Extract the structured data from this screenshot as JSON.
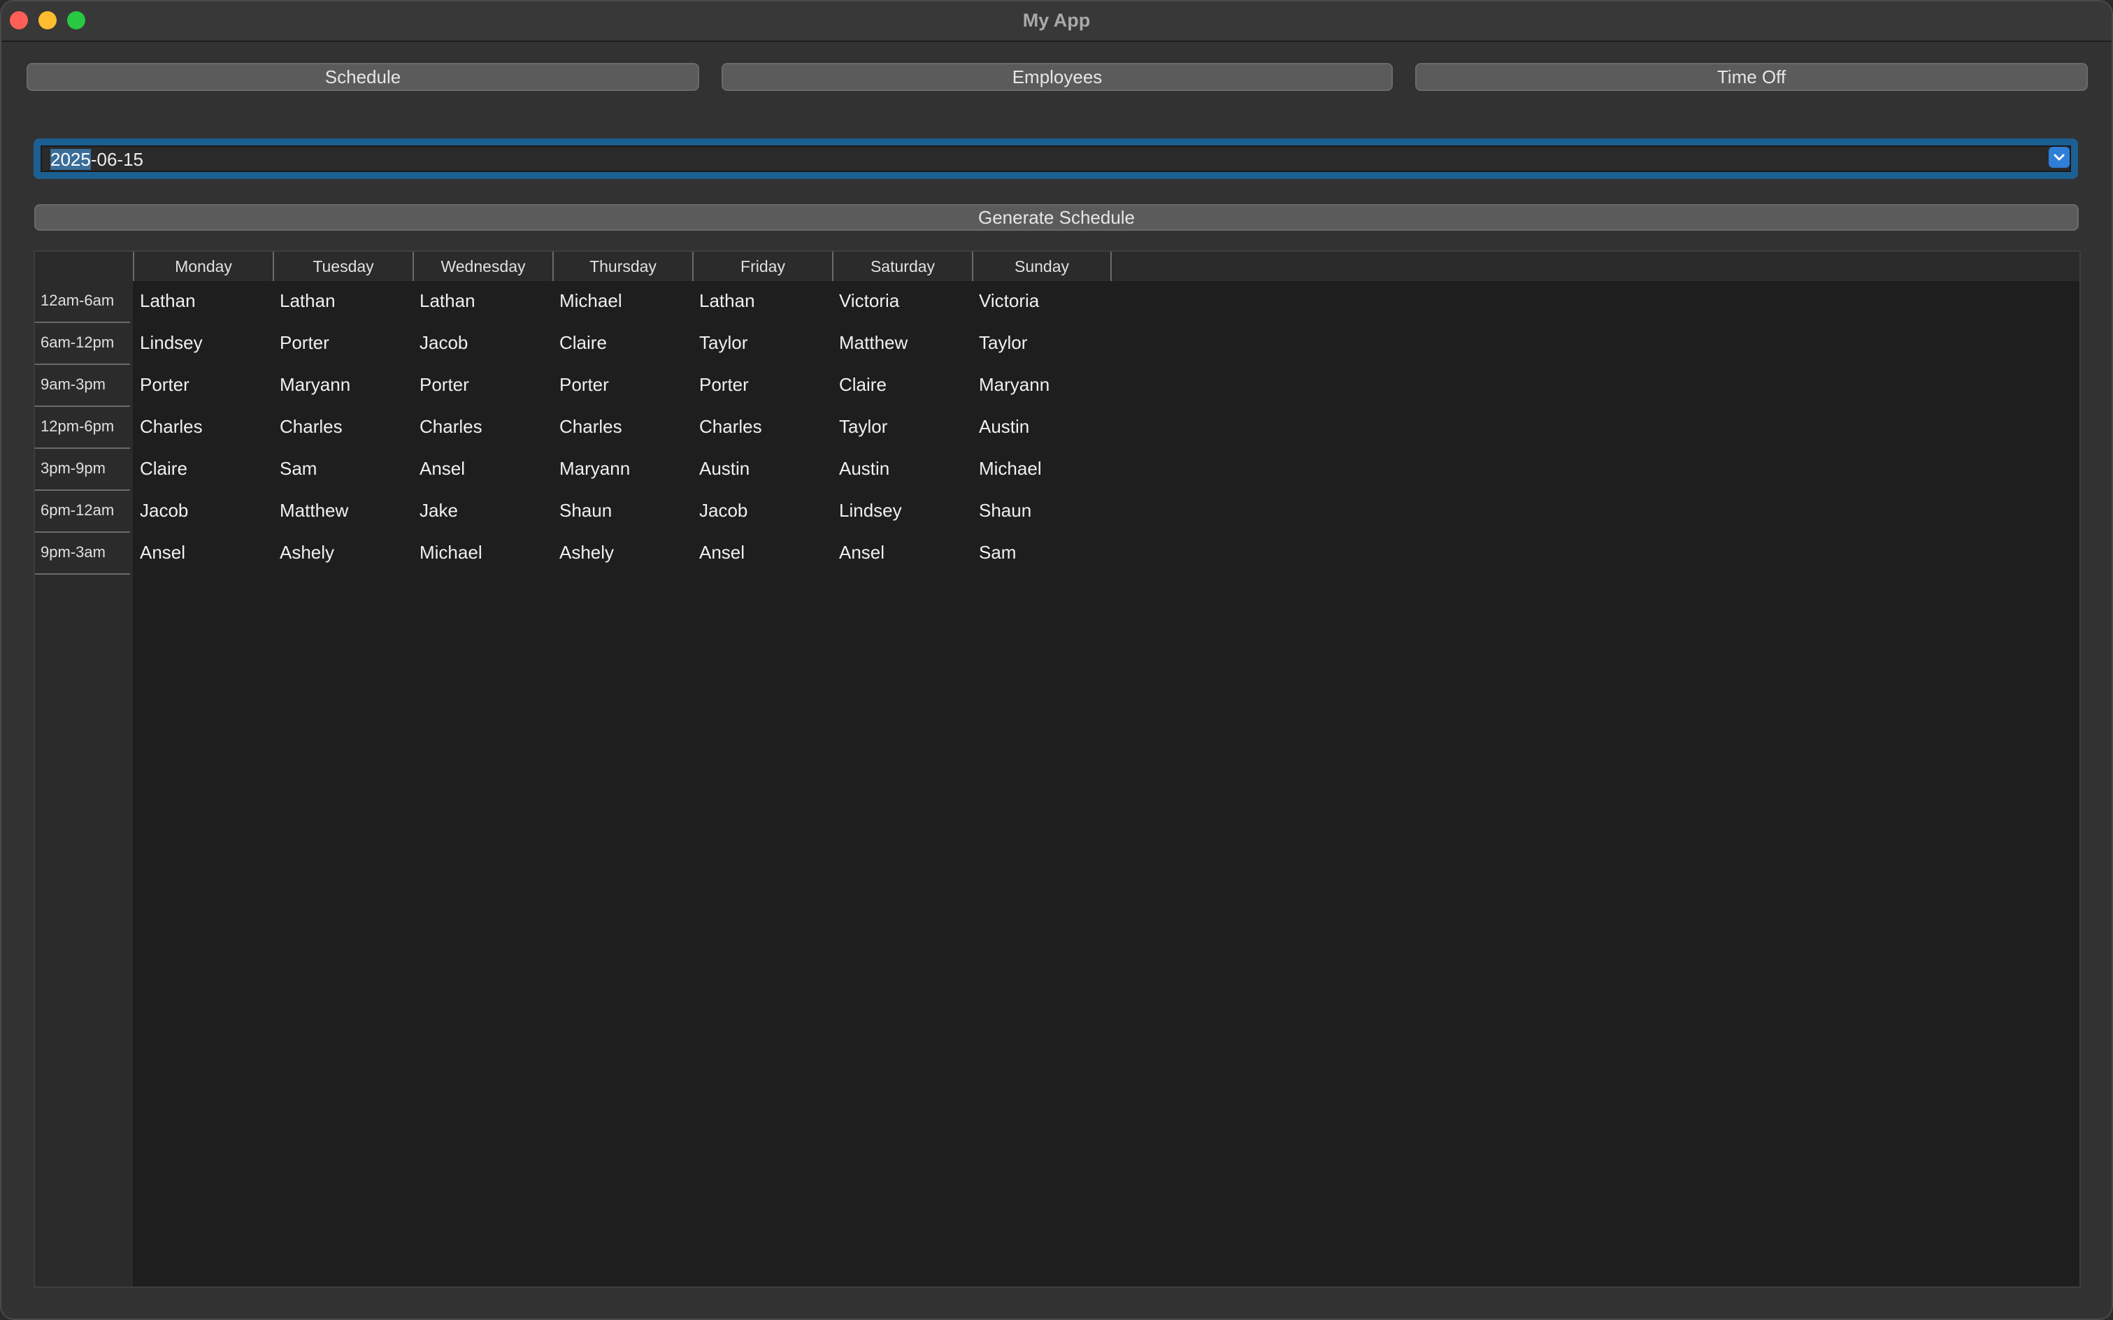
{
  "window": {
    "title": "My App"
  },
  "tabs": [
    {
      "label": "Schedule"
    },
    {
      "label": "Employees"
    },
    {
      "label": "Time Off"
    }
  ],
  "date_picker": {
    "value_selected": "2025",
    "value_rest": "-06-15",
    "dropdown_icon": "chevron-down-icon"
  },
  "generate_button": {
    "label": "Generate Schedule"
  },
  "schedule": {
    "days": [
      "Monday",
      "Tuesday",
      "Wednesday",
      "Thursday",
      "Friday",
      "Saturday",
      "Sunday"
    ],
    "shifts": [
      "12am-6am",
      "6am-12pm",
      "9am-3pm",
      "12pm-6pm",
      "3pm-9pm",
      "6pm-12am",
      "9pm-3am"
    ],
    "rows": [
      [
        "Lathan",
        "Lathan",
        "Lathan",
        "Michael",
        "Lathan",
        "Victoria",
        "Victoria"
      ],
      [
        "Lindsey",
        "Porter",
        "Jacob",
        "Claire",
        "Taylor",
        "Matthew",
        "Taylor"
      ],
      [
        "Porter",
        "Maryann",
        "Porter",
        "Porter",
        "Porter",
        "Claire",
        "Maryann"
      ],
      [
        "Charles",
        "Charles",
        "Charles",
        "Charles",
        "Charles",
        "Taylor",
        "Austin"
      ],
      [
        "Claire",
        "Sam",
        "Ansel",
        "Maryann",
        "Austin",
        "Austin",
        "Michael"
      ],
      [
        "Jacob",
        "Matthew",
        "Jake",
        "Shaun",
        "Jacob",
        "Lindsey",
        "Shaun"
      ],
      [
        "Ansel",
        "Ashely",
        "Michael",
        "Ashely",
        "Ansel",
        "Ansel",
        "Sam"
      ]
    ]
  },
  "colors": {
    "accent": "#1c5f92",
    "close": "#fe5f57",
    "minimize": "#febc2e",
    "maximize": "#28c840"
  }
}
